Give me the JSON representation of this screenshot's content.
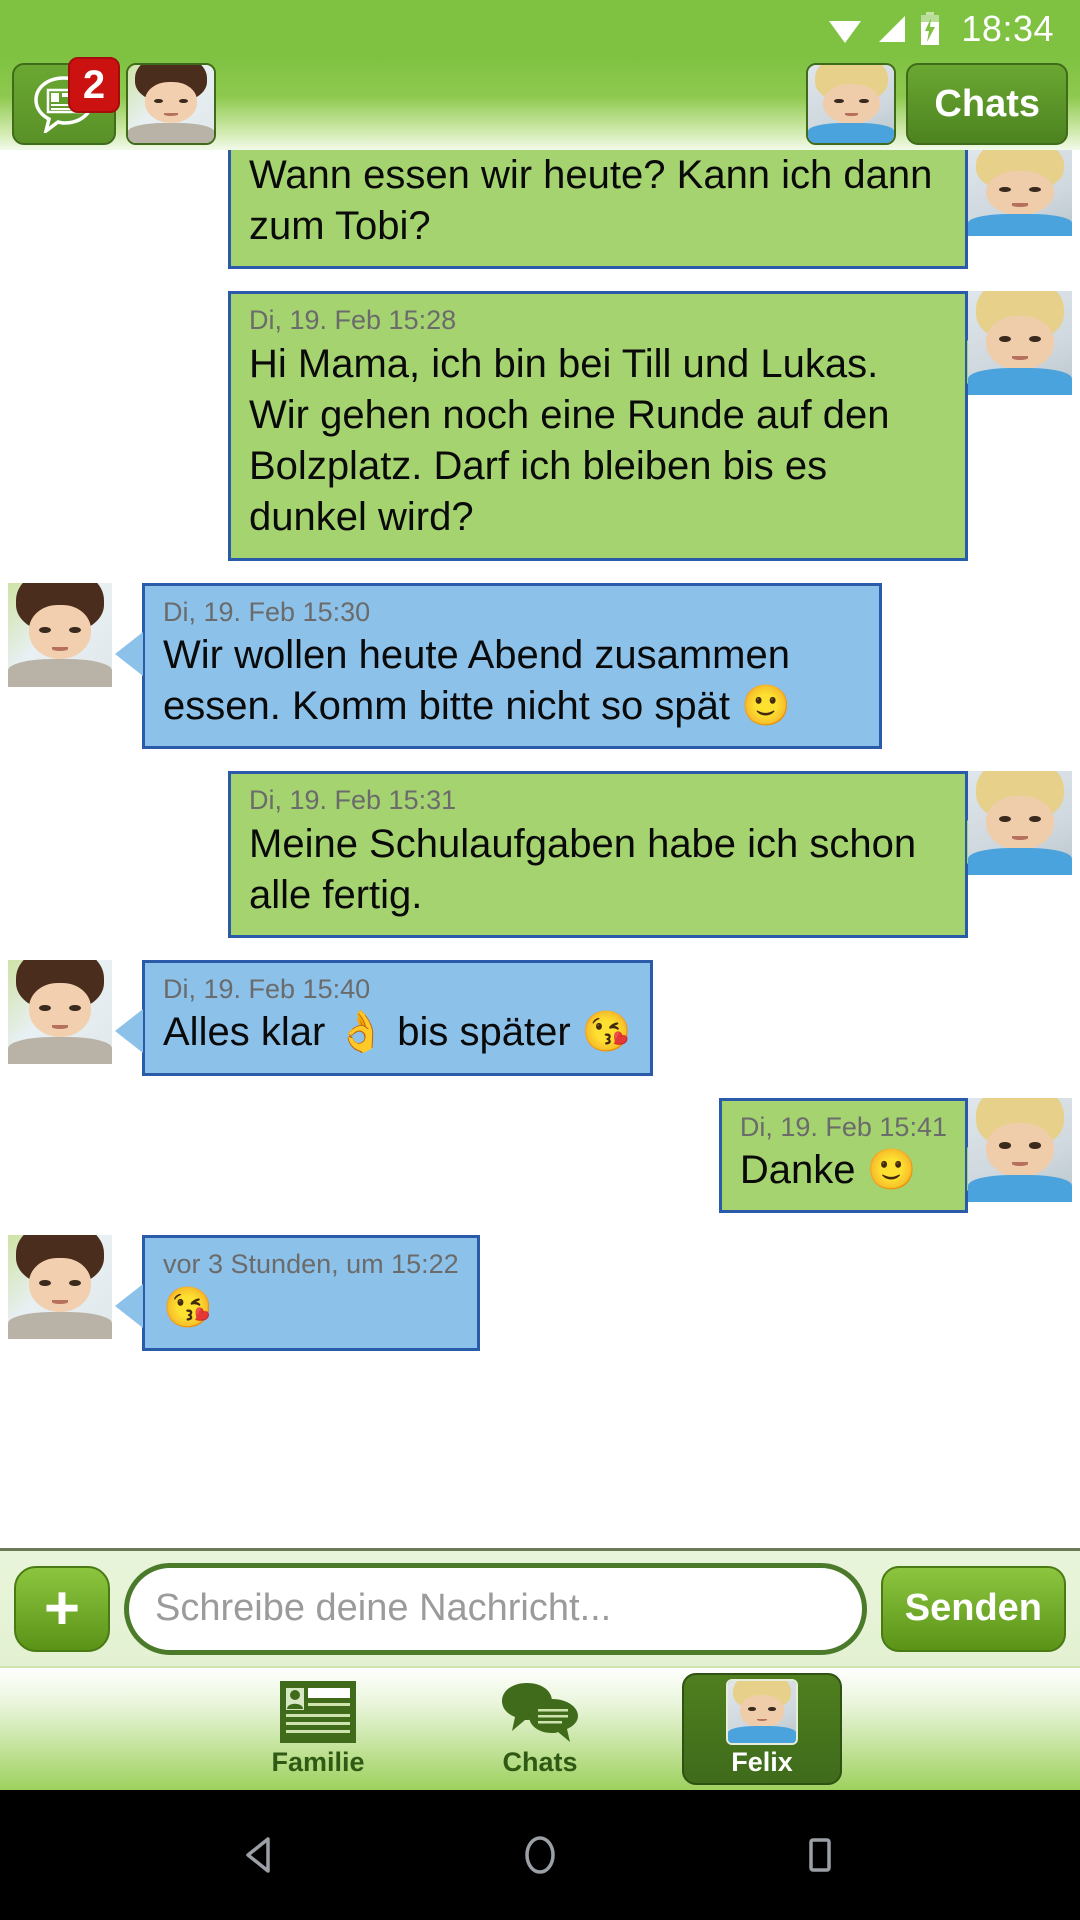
{
  "statusbar": {
    "time": "18:34",
    "icons": [
      "wifi-icon",
      "signal-icon",
      "battery-charging-icon"
    ]
  },
  "header": {
    "messages_button": {
      "icon": "chat-card-icon",
      "badge": "2"
    },
    "contact_avatar": {
      "name": "mom-avatar"
    },
    "current_chat_avatar": {
      "name": "felix-avatar"
    },
    "chats_label": "Chats"
  },
  "chat": {
    "messages": [
      {
        "side": "out",
        "color": "green",
        "time": "",
        "text": "Wann essen wir heute? Kann ich dann zum Tobi?",
        "clipped": true,
        "avatar": "felix-avatar"
      },
      {
        "side": "out",
        "color": "green",
        "time": "Di, 19. Feb 15:28",
        "text": "Hi Mama, ich bin bei Till und Lukas. Wir gehen noch eine Runde auf den Bolzplatz. Darf ich bleiben bis es dunkel wird?",
        "avatar": "felix-avatar"
      },
      {
        "side": "in",
        "color": "blue",
        "time": "Di, 19. Feb 15:30",
        "text": "Wir wollen heute Abend zusammen essen. Komm bitte nicht so spät 🙂",
        "avatar": "mom-avatar"
      },
      {
        "side": "out",
        "color": "green",
        "time": "Di, 19. Feb 15:31",
        "text": "Meine Schulaufgaben habe ich schon alle fertig.",
        "avatar": "felix-avatar"
      },
      {
        "side": "in",
        "color": "blue",
        "time": "Di, 19. Feb 15:40",
        "text": "Alles klar 👌 bis später 😘",
        "avatar": "mom-avatar"
      },
      {
        "side": "out",
        "color": "green",
        "time": "Di, 19. Feb 15:41",
        "text": "Danke 🙂",
        "avatar": "felix-avatar"
      },
      {
        "side": "in",
        "color": "blue",
        "time": "vor 3 Stunden, um 15:22",
        "text": "😘",
        "avatar": "mom-avatar"
      }
    ]
  },
  "composer": {
    "add_label": "+",
    "input_placeholder": "Schreibe deine Nachricht...",
    "input_value": "",
    "send_label": "Senden"
  },
  "bottom_nav": {
    "items": [
      {
        "label": "Familie",
        "icon": "contact-card-icon",
        "active": false
      },
      {
        "label": "Chats",
        "icon": "chat-bubbles-icon",
        "active": false
      },
      {
        "label": "Felix",
        "icon": "felix-avatar",
        "active": true
      }
    ]
  },
  "android_nav": {
    "back": "back-icon",
    "home": "home-icon",
    "recents": "recents-icon"
  },
  "colors": {
    "brand_green": "#7fc242",
    "bubble_out": "#a5d370",
    "bubble_in": "#8cc1e9",
    "bubble_border": "#2a5ba8",
    "badge_red": "#cc1111"
  }
}
